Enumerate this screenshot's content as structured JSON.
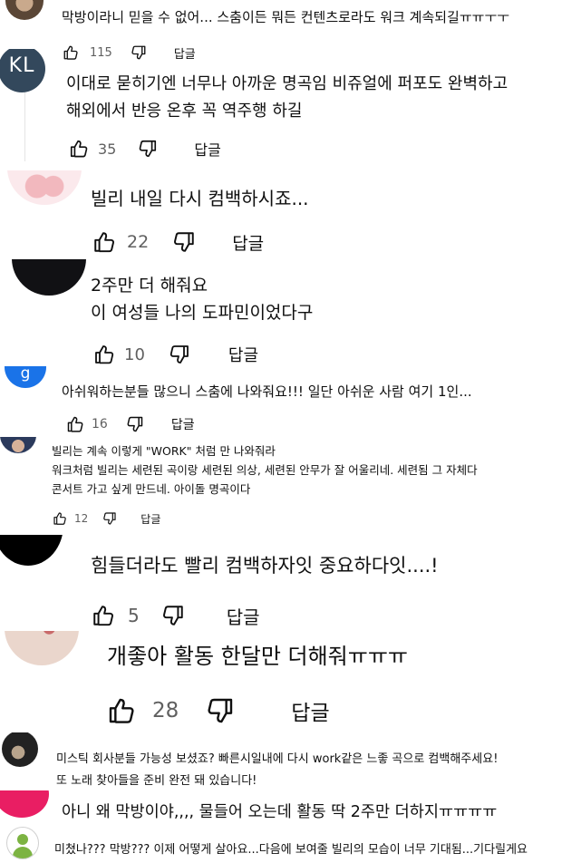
{
  "comments": [
    {
      "avatar": "",
      "text": "막방이라니 믿을 수 없어... 스춤이든 뭐든 컨텐츠로라도 워크 계속되길ㅠㅠㅜㅜ",
      "likes": "115",
      "reply": "답글"
    },
    {
      "avatar": "KL",
      "text": "이대로 묻히기엔 너무나 아까운 명곡임 비쥬얼에 퍼포도 완벽하고\n해외에서 반응 온후 꼭 역주행 하길",
      "likes": "35",
      "reply": "답글"
    },
    {
      "avatar": "",
      "text": "빌리 내일 다시 컴백하시죠...",
      "likes": "22",
      "reply": "답글"
    },
    {
      "avatar": "",
      "text": "2주만 더 해줘요\n이 여성들 나의 도파민이었다구",
      "likes": "10",
      "reply": "답글"
    },
    {
      "avatar": "g",
      "text": "아쉬워하는분들 많으니 스춤에 나와줘요!!! 일단 아쉬운 사람 여기 1인...",
      "likes": "16",
      "reply": "답글"
    },
    {
      "avatar": "",
      "text": "빌리는 계속 이렇게 \"WORK\" 처럼 만 나와줘라\n워크처럼 빌리는 세련된 곡이랑 세련된 의상, 세련된 안무가 잘 어울리네. 세련됨 그 자체다\n콘서트 가고 싶게 만드네. 아이돌 명곡이다",
      "likes": "12",
      "reply": "답글"
    },
    {
      "avatar": "",
      "text": "힘들더라도 빨리 컴백하자잇 중요하다잇....!",
      "likes": "5",
      "reply": "답글"
    },
    {
      "avatar": "",
      "text": "개좋아 활동 한달만 더해줘ㅠㅠㅠ",
      "likes": "28",
      "reply": "답글"
    },
    {
      "avatar": "",
      "text": "미스틱 회사분들 가능성 보셨죠? 빠른시일내에 다시 work같은 느좋 곡으로 컴백해주세요!\n또 노래 찾아들을 준비 완전 돼 있습니다!",
      "likes": "",
      "reply": ""
    },
    {
      "avatar": "",
      "text": "아니 왜 막방이야,,,, 물들어 오는데 활동 딱 2주만 더하지ㅠㅠㅠㅠ",
      "likes": "",
      "reply": ""
    },
    {
      "avatar": "",
      "text": "미쳤나??? 막방??? 이제 어떻게 살아요...다음에 보여줄 빌리의 모습이 너무 기대됨...기다릴게요",
      "likes": "",
      "reply": ""
    }
  ],
  "colors": {
    "text": "#0f0f0f",
    "muted": "#606060",
    "avatar_blue": "#1a73e8",
    "avatar_slate": "#33485c",
    "avatar_pink": "#e91e63",
    "avatar_green": "#7cb342"
  }
}
